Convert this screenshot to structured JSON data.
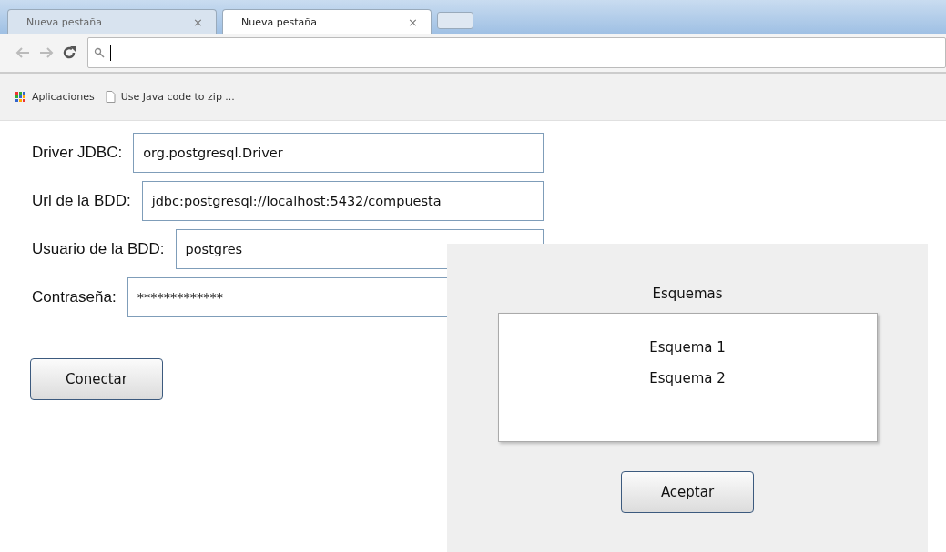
{
  "tabs": [
    {
      "label": "Nueva pestaña",
      "close": "×",
      "selected": false
    },
    {
      "label": "Nueva pestaña",
      "close": "×",
      "selected": true
    }
  ],
  "bookmarks": [
    {
      "kind": "apps",
      "label": "Aplicaciones"
    },
    {
      "kind": "page",
      "label": "Use Java code to zip ..."
    }
  ],
  "form": {
    "fields": [
      {
        "label": "Driver JDBC:",
        "value": "org.postgresql.Driver"
      },
      {
        "label": "Url de la BDD:",
        "value": "jdbc:postgresql://localhost:5432/compuesta"
      },
      {
        "label": "Usuario de la BDD:",
        "value": "postgres"
      },
      {
        "label": "Contraseña:",
        "value": "*************"
      }
    ],
    "button": "Conectar"
  },
  "dialog": {
    "title": "Esquemas",
    "items": [
      "Esquema 1",
      "Esquema 2"
    ],
    "button": "Aceptar"
  }
}
